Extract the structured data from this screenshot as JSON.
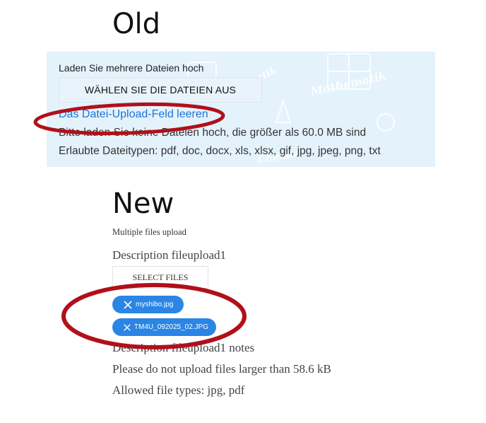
{
  "old": {
    "heading": "Old",
    "upload_label": "Laden Sie mehrere Dateien hoch",
    "select_button": "WÄHLEN SIE DIE DATEIEN AUS",
    "clear_link": "Das Datei-Upload-Feld leeren",
    "size_help": "Bitte laden Sie keine Dateien hoch, die größer als 60.0 MB sind",
    "types_help": "Erlaubte Dateitypen: pdf, doc, docx, xls, xlsx, gif, jpg, jpeg, png, txt",
    "watermark_text": [
      "Mathematik",
      "Informatik",
      "Chemie"
    ]
  },
  "new": {
    "heading": "New",
    "multi_label": "Multiple files upload",
    "description": "Description fileupload1",
    "select_button": "SELECT FILES",
    "files": [
      {
        "name": "myshibo.jpg"
      },
      {
        "name": "TM4U_092025_02.JPG"
      }
    ],
    "notes": "Description fileupload1 notes",
    "size_help": "Please do not upload files larger than 58.6 kB",
    "types_help": "Allowed file types: jpg, pdf"
  },
  "colors": {
    "panel_bg": "#e4f2fc",
    "link": "#1e73d6",
    "chip": "#2b85e4",
    "annotation": "#b0101a"
  }
}
